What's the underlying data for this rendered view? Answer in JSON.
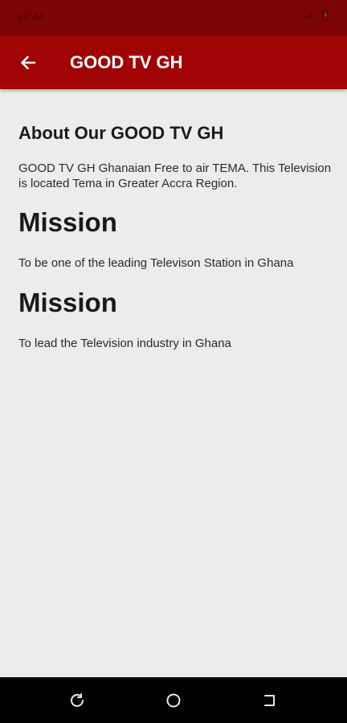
{
  "status_bar": {
    "time": "20:48",
    "background": "#7d0505"
  },
  "app_bar": {
    "title": "GOOD TV GH",
    "background": "#a00404",
    "back_icon": "arrow-left-icon"
  },
  "content": {
    "about_heading": "About Our GOOD TV GH",
    "about_text": "GOOD TV GH Ghanaian Free to air TEMA. This Television is located Tema in Greater Accra Region.",
    "sections": [
      {
        "heading": "Mission",
        "text": "To be one of the leading Televison Station in Ghana"
      },
      {
        "heading": "Mission",
        "text": "To lead the Television industry in Ghana"
      }
    ]
  },
  "nav_bar": {
    "icons": [
      "recent-apps-icon",
      "home-icon",
      "back-icon"
    ]
  }
}
